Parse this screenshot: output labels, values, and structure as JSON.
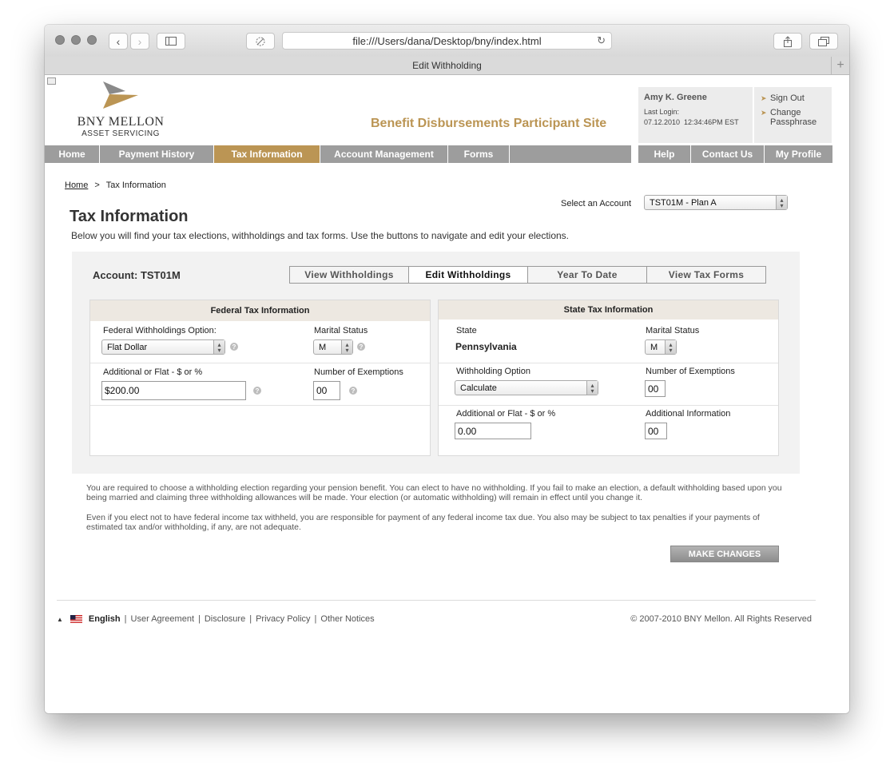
{
  "browser": {
    "url": "file:///Users/dana/Desktop/bny/index.html",
    "tab_title": "Edit Withholding",
    "new_tab": "+"
  },
  "logo": {
    "line1": "BNY MELLON",
    "line2": "ASSET SERVICING"
  },
  "site_title": "Benefit Disbursements Participant Site",
  "user": {
    "name": "Amy K. Greene",
    "last_login_label": "Last Login:",
    "last_login_value": "07.12.2010  12:34:46PM EST"
  },
  "account_links": {
    "sign_out": "Sign Out",
    "change_passphrase_1": "Change",
    "change_passphrase_2": "Passphrase"
  },
  "nav": {
    "items": [
      "Home",
      "Payment History",
      "Tax Information",
      "Account Management",
      "Forms"
    ],
    "active": "Tax Information",
    "right_items": [
      "Help",
      "Contact Us",
      "My Profile"
    ]
  },
  "breadcrumb": {
    "home": "Home",
    "sep": ">",
    "current": "Tax Information"
  },
  "account_select": {
    "label": "Select an Account",
    "value": "TST01M - Plan A"
  },
  "page": {
    "title": "Tax Information",
    "intro": "Below you will find your tax elections, withholdings and tax forms. Use the buttons to navigate and edit your elections."
  },
  "panel": {
    "account_label": "Account: TST01M",
    "tabs": [
      "View Withholdings",
      "Edit Withholdings",
      "Year To Date",
      "View Tax Forms"
    ],
    "active_tab": "Edit Withholdings"
  },
  "federal": {
    "heading": "Federal Tax Information",
    "option_label": "Federal Withholdings Option:",
    "option_value": "Flat Dollar",
    "marital_label": "Marital Status",
    "marital_value": "M",
    "additional_label": "Additional or Flat - $ or %",
    "additional_value": "$200.00",
    "exemptions_label": "Number of Exemptions",
    "exemptions_value": "00"
  },
  "state": {
    "heading": "State Tax Information",
    "state_label": "State",
    "state_value": "Pennsylvania",
    "marital_label": "Marital Status",
    "marital_value": "M",
    "withholding_label": "Withholding Option",
    "withholding_value": "Calculate",
    "exemptions_label": "Number of Exemptions",
    "exemptions_value": "00",
    "additional_label": "Additional or Flat - $ or %",
    "additional_value": "0.00",
    "info_label": "Additional Information",
    "info_value": "00"
  },
  "disclaimer": {
    "p1": "You are required to choose a withholding election regarding your pension benefit.  You can elect to have no withholding.  If you fail to make an election, a default withholding based upon you being married and claiming three withholding allowances will be made.  Your election (or automatic withholding) will remain in effect until you change it.",
    "p2": "Even if you elect not to have federal income tax withheld, you are responsible for payment of any federal income tax due.  You also may be subject to tax penalties if your payments of estimated tax and/or withholding, if any, are not adequate."
  },
  "make_changes": "MAKE CHANGES",
  "footer": {
    "language": "English",
    "links": [
      "User Agreement",
      "Disclosure",
      "Privacy Policy",
      "Other Notices"
    ],
    "separator": "|",
    "copyright": "© 2007-2010 BNY Mellon. All Rights Reserved"
  },
  "colors": {
    "gold": "#bb9554",
    "nav_gray": "#9d9d9d",
    "panel_bg": "#f2f2f2",
    "box_head": "#ede8e1"
  }
}
